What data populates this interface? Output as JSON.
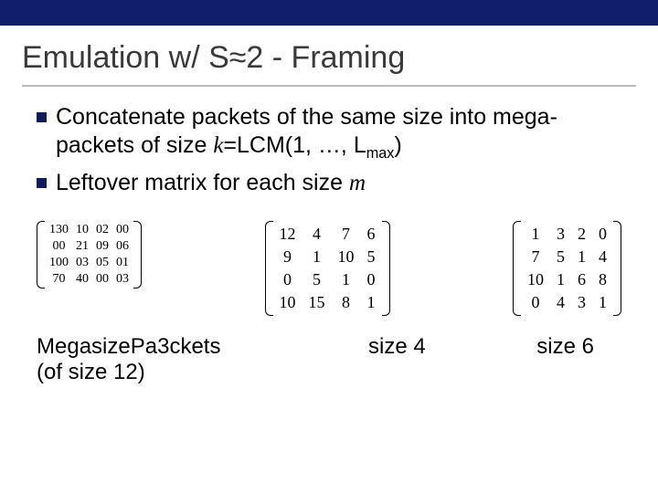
{
  "title": "Emulation w/ S≈2 - Framing",
  "bullets": {
    "b1_pre": "Concatenate packets of the same size into mega-packets of size ",
    "b1_k": "k",
    "b1_mid": "=LCM(1, …, L",
    "b1_sub": "max",
    "b1_end": ")",
    "b2_pre": "Leftover matrix for each size ",
    "b2_m": "m"
  },
  "matrix1": {
    "type": "small",
    "rows": [
      [
        "130",
        "10",
        "02",
        "00"
      ],
      [
        "00",
        "21",
        "09",
        "06"
      ],
      [
        "100",
        "03",
        "05",
        "01"
      ],
      [
        "70",
        "40",
        "00",
        "03"
      ]
    ]
  },
  "matrix2": {
    "rows": [
      [
        "12",
        "4",
        "7",
        "6"
      ],
      [
        "9",
        "1",
        "10",
        "5"
      ],
      [
        "0",
        "5",
        "1",
        "0"
      ],
      [
        "10",
        "15",
        "8",
        "1"
      ]
    ]
  },
  "matrix3": {
    "rows": [
      [
        "1",
        "3",
        "2",
        "0"
      ],
      [
        "7",
        "5",
        "1",
        "4"
      ],
      [
        "10",
        "1",
        "6",
        "8"
      ],
      [
        "0",
        "4",
        "3",
        "1"
      ]
    ]
  },
  "captions": {
    "c1_line1a": "Mega",
    "c1_line1b": "size",
    "c1_line1c": "Pa",
    "c1_line1d": "3",
    "c1_line1e": "ckets",
    "c1_line2": "(of size 12)",
    "c2": "size 4",
    "c3": "size 6"
  }
}
